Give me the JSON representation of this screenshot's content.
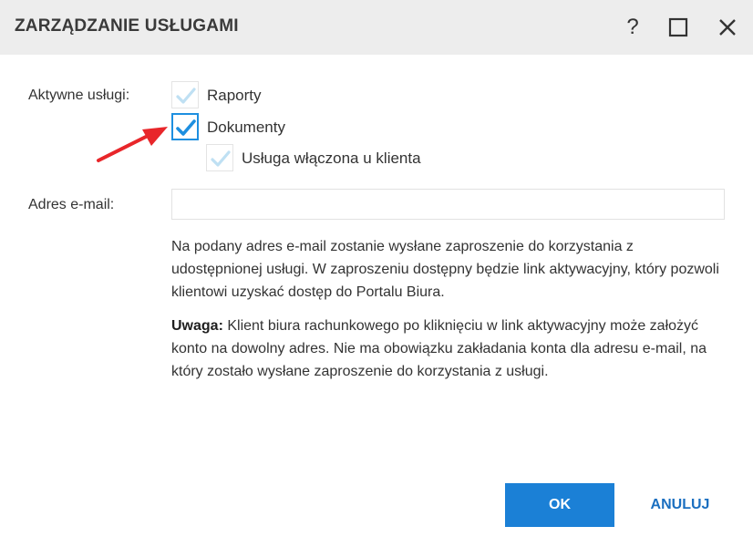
{
  "dialog": {
    "title": "ZARZĄDZANIE USŁUGAMI",
    "help_glyph": "?"
  },
  "services": {
    "label": "Aktywne usługi:",
    "items": [
      {
        "label": "Raporty",
        "checked": false
      },
      {
        "label": "Dokumenty",
        "checked": true
      },
      {
        "label": "Usługa włączona u klienta",
        "checked": false
      }
    ]
  },
  "email": {
    "label": "Adres e-mail:",
    "value": "",
    "placeholder": ""
  },
  "info": {
    "paragraph1": "Na podany adres e-mail zostanie wysłane zaproszenie do korzystania z udostępnionej usługi. W zaproszeniu dostępny będzie link aktywacyjny, który pozwoli klientowi uzyskać dostęp do Portalu Biura.",
    "note_label": "Uwaga:",
    "note_text": " Klient biura rachunkowego po kliknięciu w link aktywacyjny może założyć konto na dowolny adres. Nie ma obowiązku zakładania konta dla adresu e-mail, na który zostało wysłane zaproszenie do korzystania z usługi."
  },
  "buttons": {
    "ok": "OK",
    "cancel": "ANULUJ"
  },
  "colors": {
    "accent": "#1b80d6",
    "titlebar": "#ededed",
    "annotation_arrow": "#e8262a",
    "check_checked": "#1d8fe0",
    "check_unchecked": "#bfe0f3"
  },
  "icons": [
    "help-icon",
    "maximize-icon",
    "close-icon",
    "checkmark-icon",
    "annotation-arrow"
  ]
}
